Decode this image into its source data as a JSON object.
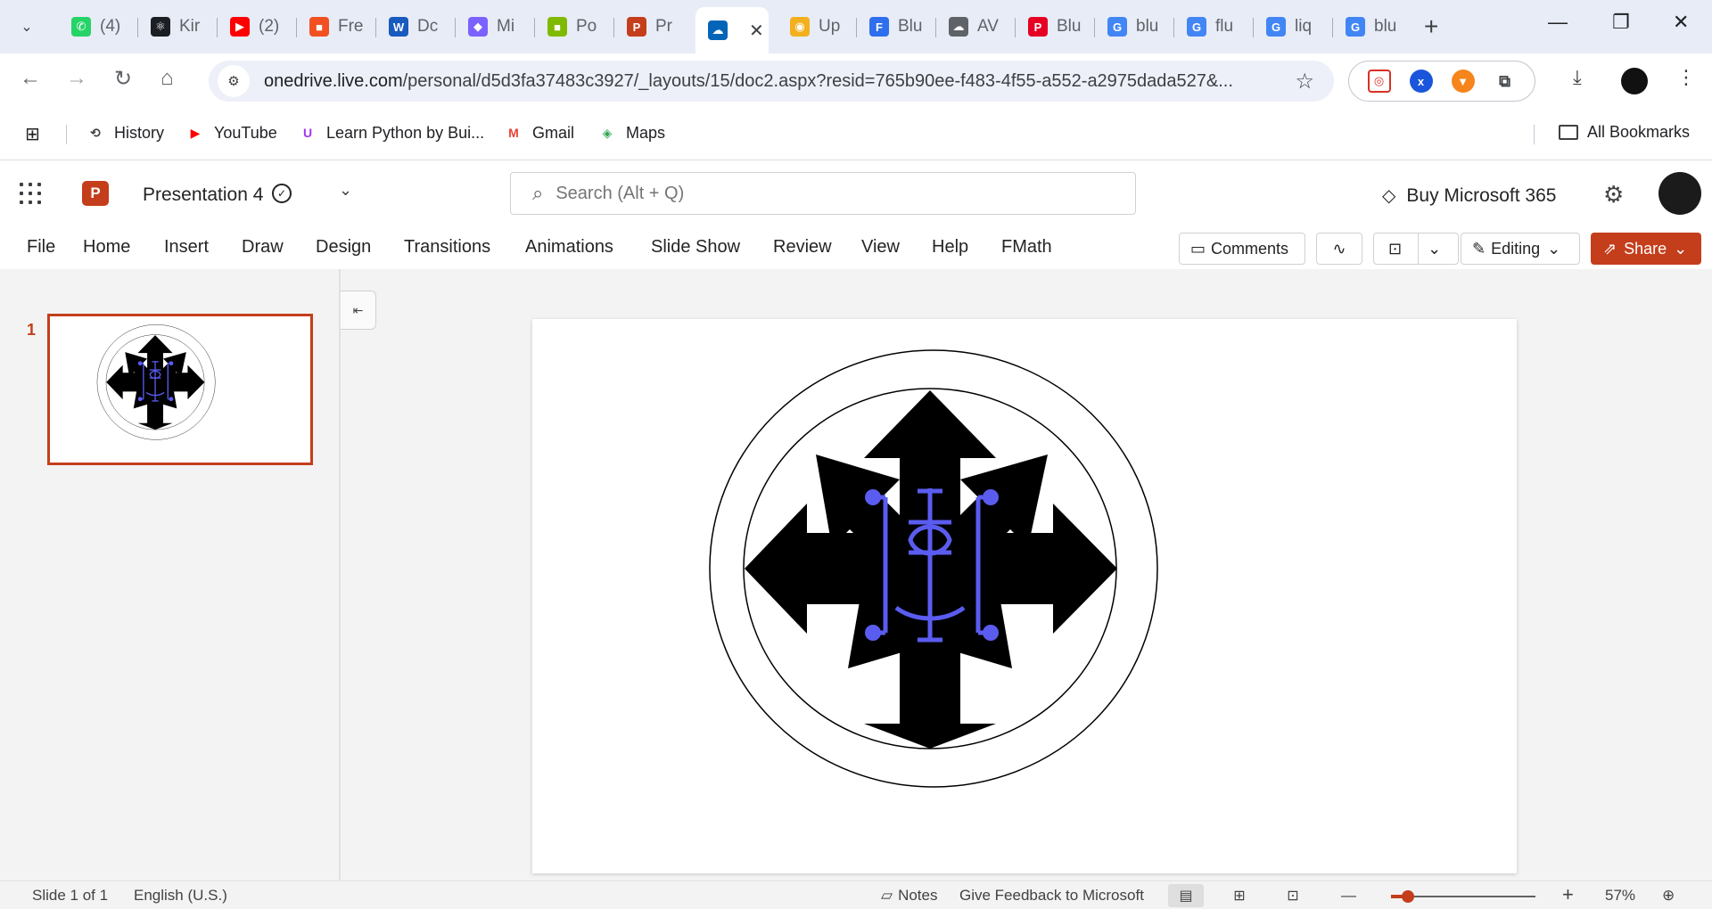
{
  "browser": {
    "tabs": [
      {
        "title": "(4)",
        "icon": "whatsapp-icon",
        "color": "#25d366",
        "glyph": "✆"
      },
      {
        "title": "Kir",
        "icon": "react-icon",
        "color": "#1b1f24",
        "glyph": "⚛"
      },
      {
        "title": "(2)",
        "icon": "youtube-icon",
        "color": "#ff0000",
        "glyph": "▶"
      },
      {
        "title": "Fre",
        "icon": "microsoft-icon",
        "color": "#f25022",
        "glyph": "■"
      },
      {
        "title": "Dc",
        "icon": "word-icon",
        "color": "#185abd",
        "glyph": "W"
      },
      {
        "title": "Mi",
        "icon": "copilot-icon",
        "color": "#7b61ff",
        "glyph": "◆"
      },
      {
        "title": "Po",
        "icon": "microsoft-icon",
        "color": "#7fba00",
        "glyph": "■"
      },
      {
        "title": "Pr",
        "icon": "powerpoint-icon",
        "color": "#c43e1c",
        "glyph": "P"
      },
      {
        "title": "",
        "icon": "onedrive-icon",
        "color": "#0364b8",
        "glyph": "☁",
        "active": true
      },
      {
        "title": "Up",
        "icon": "study-icon",
        "color": "#f2b01e",
        "glyph": "◉"
      },
      {
        "title": "Blu",
        "icon": "forms-icon",
        "color": "#2f6fed",
        "glyph": "F"
      },
      {
        "title": "AV",
        "icon": "cloud-icon",
        "color": "#5f6368",
        "glyph": "☁"
      },
      {
        "title": "Blu",
        "icon": "pinterest-icon",
        "color": "#e60023",
        "glyph": "P"
      },
      {
        "title": "blu",
        "icon": "google-icon",
        "color": "#4285f4",
        "glyph": "G"
      },
      {
        "title": "flu",
        "icon": "google-icon",
        "color": "#4285f4",
        "glyph": "G"
      },
      {
        "title": "liq",
        "icon": "google-icon",
        "color": "#4285f4",
        "glyph": "G"
      },
      {
        "title": "blu",
        "icon": "google-icon",
        "color": "#4285f4",
        "glyph": "G"
      }
    ],
    "url_host": "onedrive.live.com",
    "url_path": "/personal/d5d3fa37483c3927/_layouts/15/doc2.aspx?resid=765b90ee-f483-4f55-a552-a2975dada527&...",
    "bookmarks": [
      {
        "label": "History",
        "icon": "history-icon",
        "glyph": "⟲",
        "color": "#3c4043"
      },
      {
        "label": "YouTube",
        "icon": "youtube-icon",
        "glyph": "▶",
        "color": "#ff0000"
      },
      {
        "label": "Learn Python by Bui...",
        "icon": "udemy-icon",
        "glyph": "U",
        "color": "#a435f0"
      },
      {
        "label": "Gmail",
        "icon": "gmail-icon",
        "glyph": "M",
        "color": "#ea4335"
      },
      {
        "label": "Maps",
        "icon": "maps-icon",
        "glyph": "◈",
        "color": "#34a853"
      }
    ],
    "all_bookmarks": "All Bookmarks"
  },
  "app": {
    "doc_name": "Presentation 4",
    "search_placeholder": "Search (Alt + Q)",
    "buy": "Buy Microsoft 365",
    "ribbon_tabs": [
      "File",
      "Home",
      "Insert",
      "Draw",
      "Design",
      "Transitions",
      "Animations",
      "Slide Show",
      "Review",
      "View",
      "Help",
      "FMath"
    ],
    "comments": "Comments",
    "editing": "Editing",
    "share": "Share",
    "accent": "#c43e1c"
  },
  "slides": {
    "current_number": "1",
    "symbol_color": "#5a5cf0"
  },
  "status": {
    "slide_of": "Slide 1 of 1",
    "language": "English (U.S.)",
    "notes": "Notes",
    "feedback": "Give Feedback to Microsoft",
    "zoom": "57%",
    "zoom_fraction": 0.12
  }
}
